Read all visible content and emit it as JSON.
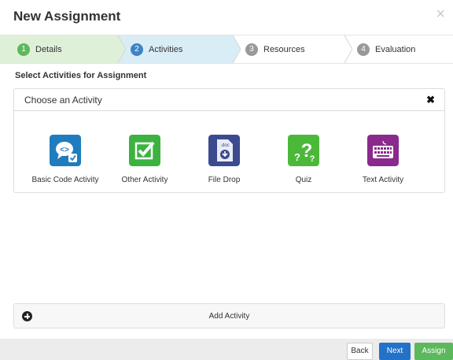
{
  "header": {
    "title": "New Assignment",
    "close_glyph": "×"
  },
  "steps": [
    {
      "num": "1",
      "label": "Details",
      "state": "complete",
      "color": "#5cb85c"
    },
    {
      "num": "2",
      "label": "Activities",
      "state": "active",
      "color": "#3d84c6"
    },
    {
      "num": "3",
      "label": "Resources",
      "state": "pending",
      "color": "#999999"
    },
    {
      "num": "4",
      "label": "Evaluation",
      "state": "pending",
      "color": "#999999"
    }
  ],
  "section_label": "Select Activities for Assignment",
  "panel": {
    "title": "Choose an Activity",
    "close_glyph": "✖",
    "activities": [
      {
        "label": "Basic Code Activity",
        "icon": "code-bubble-icon",
        "color": "#1f7dbf"
      },
      {
        "label": "Other Activity",
        "icon": "checkbox-icon",
        "color": "#3cb340"
      },
      {
        "label": "File Drop",
        "icon": "doc-download-icon",
        "color": "#3c4a8f"
      },
      {
        "label": "Quiz",
        "icon": "question-marks-icon",
        "color": "#4cb83a"
      },
      {
        "label": "Text Activity",
        "icon": "keyboard-icon",
        "color": "#8a2a8c"
      }
    ]
  },
  "add_activity": {
    "label": "Add Activity"
  },
  "footer": {
    "back": "Back",
    "next": "Next",
    "assign": "Assign"
  }
}
